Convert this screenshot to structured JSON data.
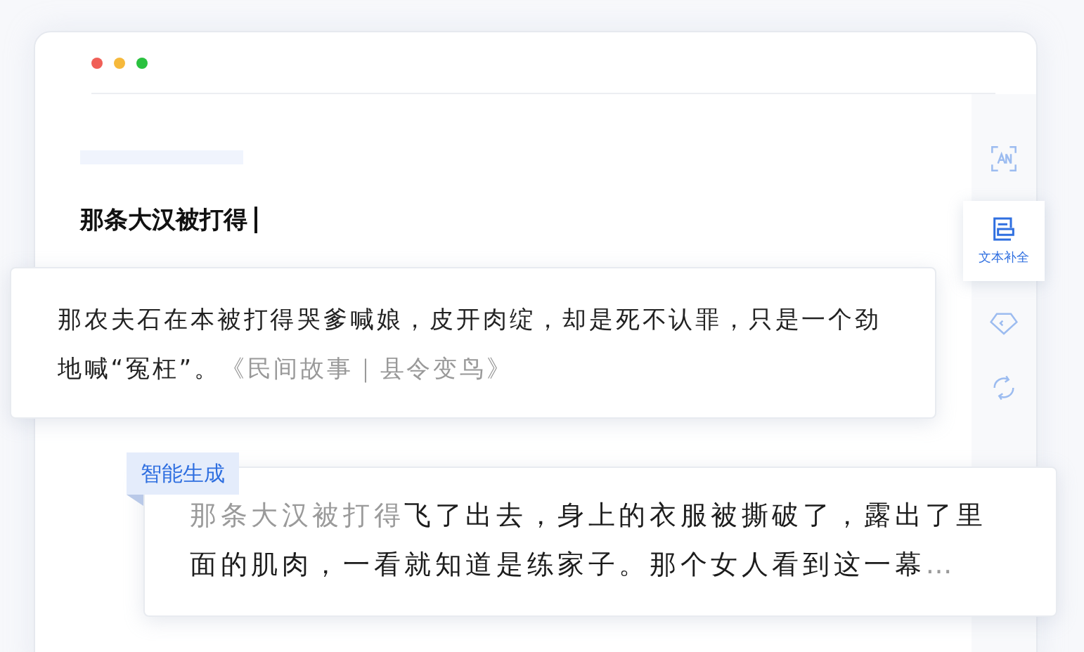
{
  "editor": {
    "title": "那条大汉被打得"
  },
  "sidebar": {
    "items": [
      {
        "kind": "scan",
        "selected": false
      },
      {
        "kind": "document",
        "label": "文本补全",
        "selected": true
      },
      {
        "kind": "tag",
        "selected": false
      },
      {
        "kind": "convert",
        "selected": false
      }
    ]
  },
  "quote_card": {
    "text": "那农夫石在本被打得哭爹喊娘，皮开肉绽，却是死不认罪，只是一个劲地喊“冤枉”。",
    "source": "《民间故事｜县令变鸟》"
  },
  "generated_card": {
    "tag": "智能生成",
    "prompt": "那条大汉被打得",
    "continuation": "飞了出去，身上的衣服被撕破了，露出了里面的肌肉，一看就知道是练家子。那个女人看到这一幕",
    "ellipsis": "…"
  }
}
